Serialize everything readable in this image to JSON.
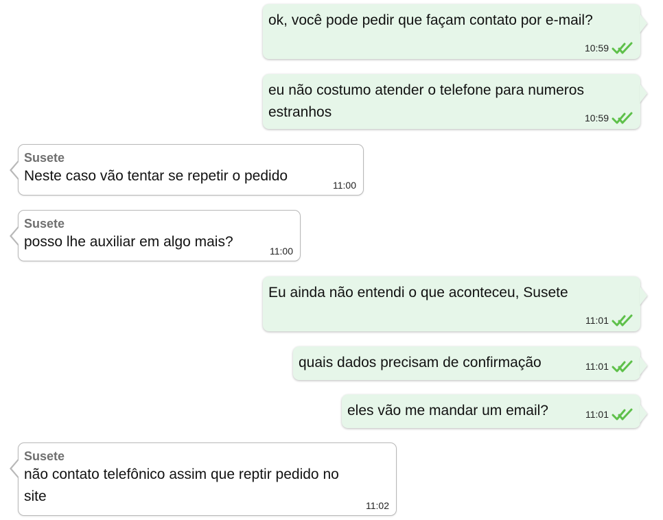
{
  "colors": {
    "outgoing_bubble": "#e6f6e9",
    "incoming_bubble": "#ffffff",
    "read_ticks": "#5ec04a",
    "sender_name": "#6f6f6f"
  },
  "messages": [
    {
      "direction": "outgoing",
      "text": "ok, você pode pedir que façam contato por e-mail?",
      "time": "10:59",
      "status_icon": "double-check-icon"
    },
    {
      "direction": "outgoing",
      "text": "eu não costumo atender o telefone para numeros\nestranhos",
      "time": "10:59",
      "status_icon": "double-check-icon"
    },
    {
      "direction": "incoming",
      "sender": "Susete",
      "text": "Neste caso vão tentar se repetir o pedido",
      "time": "11:00"
    },
    {
      "direction": "incoming",
      "sender": "Susete",
      "text": "posso lhe auxiliar em algo mais?",
      "time": "11:00"
    },
    {
      "direction": "outgoing",
      "text": "Eu ainda não entendi o que aconteceu, Susete",
      "time": "11:01",
      "status_icon": "double-check-icon"
    },
    {
      "direction": "outgoing",
      "text": "quais dados precisam de confirmação",
      "time": "11:01",
      "status_icon": "double-check-icon"
    },
    {
      "direction": "outgoing",
      "text": "eles vão me mandar um email?",
      "time": "11:01",
      "status_icon": "double-check-icon"
    },
    {
      "direction": "incoming",
      "sender": "Susete",
      "text": "não contato telefônico assim que reptir pedido no\nsite",
      "time": "11:02"
    }
  ]
}
